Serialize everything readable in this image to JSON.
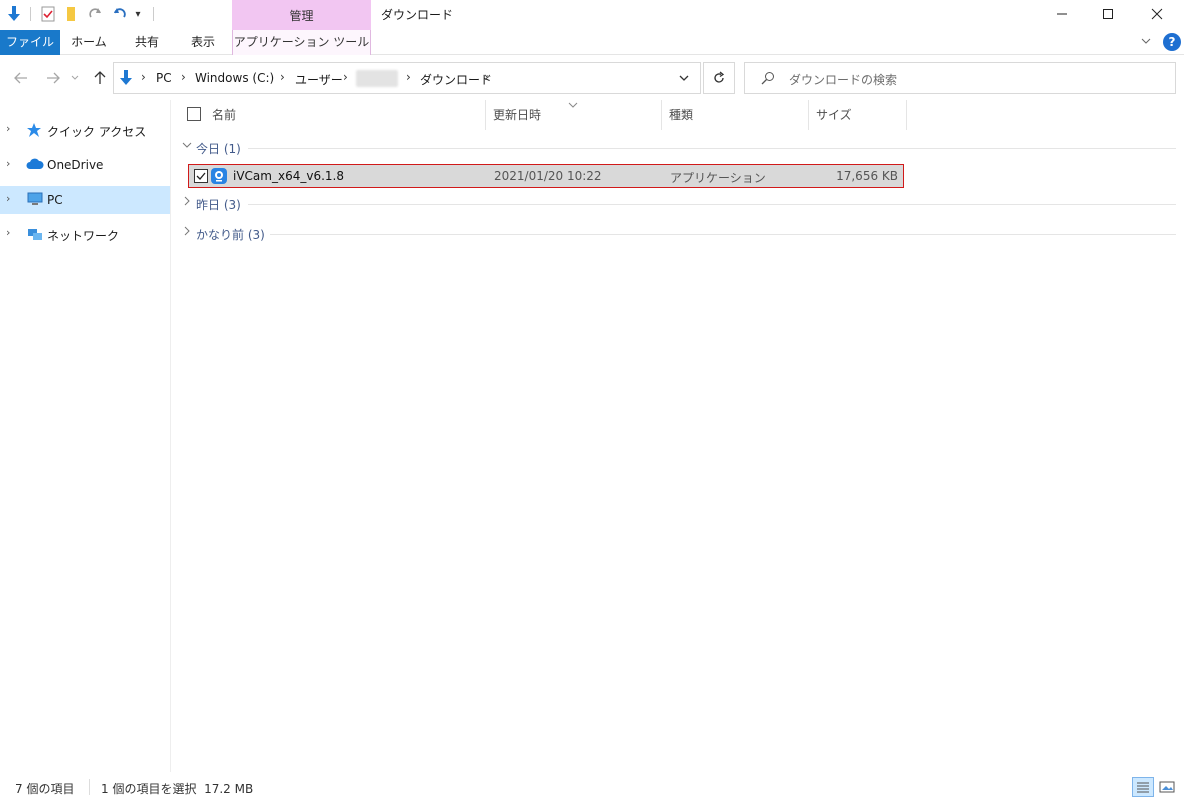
{
  "window": {
    "title": "ダウンロード",
    "context_tab_group": "管理"
  },
  "ribbon": {
    "tabs": [
      {
        "label": "ファイル"
      },
      {
        "label": "ホーム"
      },
      {
        "label": "共有"
      },
      {
        "label": "表示"
      }
    ],
    "context_tab": "アプリケーション ツール"
  },
  "address_bar": {
    "breadcrumbs": [
      "PC",
      "Windows (C:)",
      "ユーザー",
      "ダウンロード"
    ]
  },
  "search": {
    "placeholder": "ダウンロードの検索"
  },
  "nav_pane": {
    "items": [
      {
        "label": "クイック アクセス",
        "icon": "star-icon"
      },
      {
        "label": "OneDrive",
        "icon": "cloud-icon"
      },
      {
        "label": "PC",
        "icon": "computer-icon",
        "selected": true
      },
      {
        "label": "ネットワーク",
        "icon": "network-icon"
      }
    ]
  },
  "columns": {
    "name": "名前",
    "date": "更新日時",
    "type": "種類",
    "size": "サイズ"
  },
  "groups": [
    {
      "label": "今日 (1)",
      "expanded": true
    },
    {
      "label": "昨日 (3)",
      "expanded": false
    },
    {
      "label": "かなり前 (3)",
      "expanded": false
    }
  ],
  "files": [
    {
      "name": "iVCam_x64_v6.1.8",
      "modified": "2021/01/20 10:22",
      "type": "アプリケーション",
      "size": "17,656 KB",
      "selected": true
    }
  ],
  "status_bar": {
    "item_count": "7 個の項目",
    "selection": "1 個の項目を選択  17.2 MB"
  },
  "colors": {
    "accent": "#1979ca",
    "context_tab": "#f2c6f2",
    "nav_selected": "#cce8ff",
    "row_selected": "#d9d9d9",
    "highlight_border": "#d11a1a"
  }
}
